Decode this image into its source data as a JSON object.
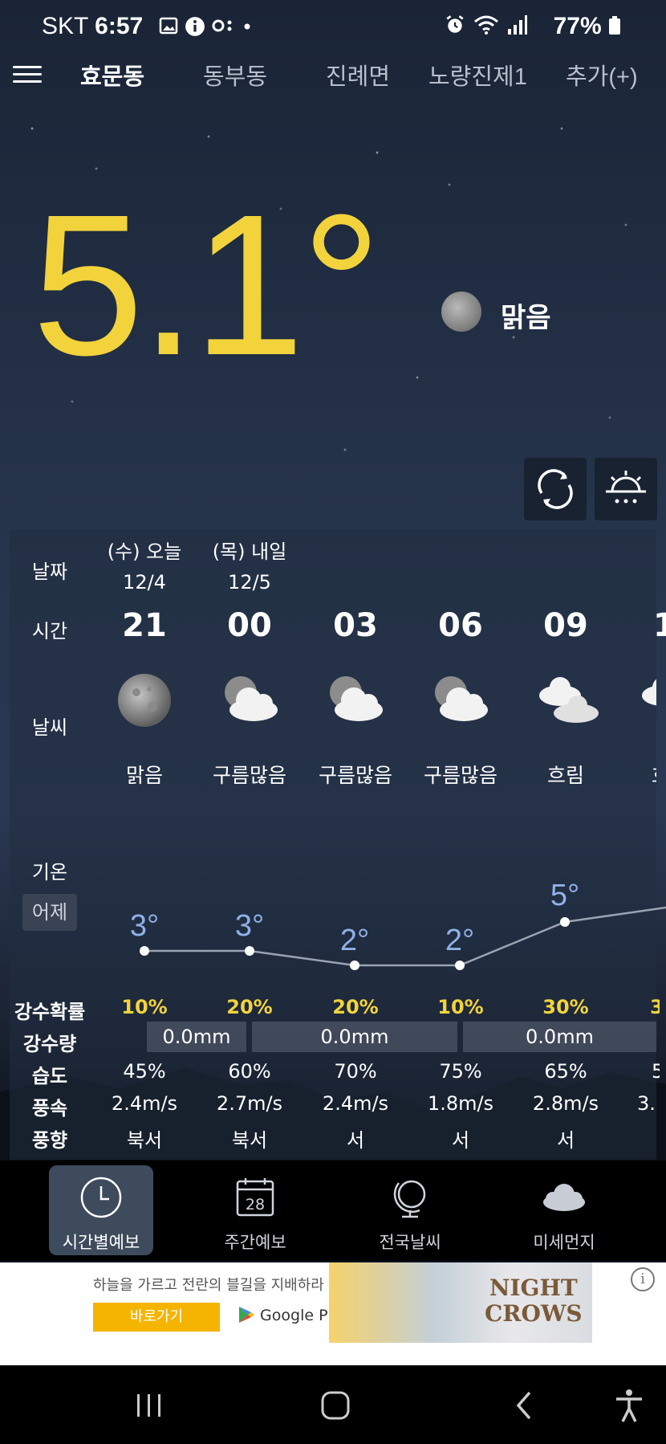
{
  "status_bar": {
    "carrier": "SKT",
    "time": "6:57",
    "battery": "77%"
  },
  "top_nav": {
    "tabs": [
      {
        "label": "효문동",
        "active": true
      },
      {
        "label": "동부동",
        "active": false
      },
      {
        "label": "진례면",
        "active": false
      },
      {
        "label": "노량진제1",
        "active": false
      },
      {
        "label": "추가(+)",
        "active": false
      }
    ]
  },
  "current": {
    "temperature": "5.1°",
    "condition": "맑음"
  },
  "forecast": {
    "row_labels": {
      "date": "날짜",
      "time": "시간",
      "weather": "날씨",
      "temp": "기온",
      "yesterday": "어제",
      "precip_prob": "강수확률",
      "precip_amount": "강수량",
      "humidity": "습도",
      "wind_speed": "풍속",
      "wind_dir": "풍향"
    },
    "dates": [
      {
        "day": "(수) 오늘",
        "date": "12/4"
      },
      {
        "day": "(목) 내일",
        "date": "12/5"
      }
    ],
    "hours": [
      "21",
      "00",
      "03",
      "06",
      "09",
      "1"
    ],
    "conditions": [
      "맑음",
      "구름많음",
      "구름많음",
      "구름많음",
      "흐림",
      "흐"
    ],
    "icons": [
      "moon-icon",
      "cloudy-night-icon",
      "cloudy-night-icon",
      "cloudy-night-icon",
      "overcast-icon",
      "overcast-icon"
    ],
    "temps": [
      "3°",
      "3°",
      "2°",
      "2°",
      "5°"
    ],
    "temp_values": [
      3,
      3,
      2,
      2,
      5,
      6
    ],
    "precip_prob": [
      "10%",
      "20%",
      "20%",
      "10%",
      "30%",
      "3"
    ],
    "precip_amount": [
      "0.0mm",
      "0.0mm",
      "0.0mm"
    ],
    "humidity": [
      "45%",
      "60%",
      "70%",
      "75%",
      "65%",
      "5"
    ],
    "wind_speed": [
      "2.4m/s",
      "2.7m/s",
      "2.4m/s",
      "1.8m/s",
      "2.8m/s",
      "3."
    ],
    "wind_dir": [
      "북서",
      "북서",
      "서",
      "서",
      "서"
    ]
  },
  "bottom_nav": {
    "items": [
      {
        "label": "시간별예보",
        "active": true
      },
      {
        "label": "주간예보",
        "icon_text": "28",
        "active": false
      },
      {
        "label": "전국날씨",
        "active": false
      },
      {
        "label": "미세먼지",
        "active": false
      }
    ]
  },
  "ad": {
    "text": "하늘을 가르고 전란의 블길을 지배하라",
    "button": "바로가기",
    "store": "Google Play",
    "brand_line1": "NIGHT",
    "brand_line2": "CROWS",
    "info": "i"
  },
  "colors": {
    "accent_yellow": "#f2d33c",
    "temp_blue": "#8eb1e6"
  }
}
